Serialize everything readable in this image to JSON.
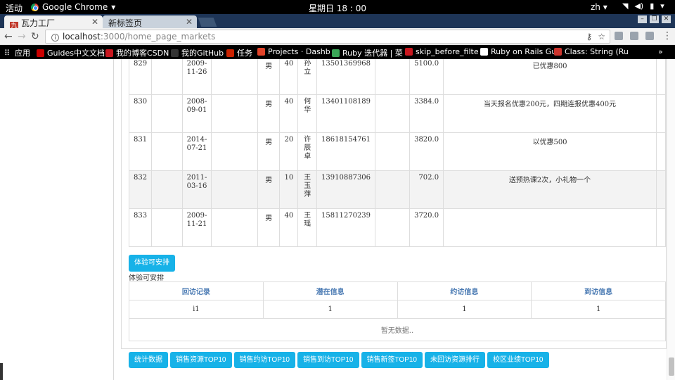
{
  "system": {
    "activities": "活动",
    "app_name": "Google Chrome",
    "clock": "星期日 18 : 00",
    "lang": "zh"
  },
  "tabs": [
    {
      "title": "瓦力工厂",
      "favicon": "九",
      "active": true
    },
    {
      "title": "新标签页",
      "active": false
    }
  ],
  "address": {
    "host": "localhost",
    "path": ":3000/home_page_markets"
  },
  "bookmarks": [
    {
      "label": "应用",
      "icon": "apps-icon"
    },
    {
      "label": "Guides中文文档",
      "icon": "rails-icon",
      "color": "#cc0000"
    },
    {
      "label": "我的博客CSDN",
      "icon": "csdn-icon",
      "color": "#c9171f"
    },
    {
      "label": "我的GitHub",
      "icon": "github-icon",
      "color": "#333333"
    },
    {
      "label": "任务",
      "icon": "task-icon",
      "color": "#cc2200"
    },
    {
      "label": "Projects · Dashb",
      "icon": "gitlab-icon",
      "color": "#e24329"
    },
    {
      "label": "Ruby 迭代器 | 菜",
      "icon": "ruby-icon",
      "color": "#3aa757"
    },
    {
      "label": "skip_before_filte",
      "icon": "csdn-icon",
      "color": "#c9171f"
    },
    {
      "label": "Ruby on Rails Gu",
      "icon": "page-icon",
      "color": "#ffffff"
    },
    {
      "label": "Class: String (Ru",
      "icon": "ruby-icon",
      "color": "#cc342d"
    }
  ],
  "records": [
    {
      "id": "829",
      "date": [
        "2009-",
        "11-26"
      ],
      "gender": "男",
      "age": "40",
      "name": [
        "孙",
        "立"
      ],
      "phone": "13501369968",
      "price": "5100.0",
      "note": "已优惠800",
      "striped": false
    },
    {
      "id": "830",
      "date": [
        "2008-",
        "09-01"
      ],
      "gender": "男",
      "age": "40",
      "name": [
        "何",
        "华"
      ],
      "phone": "13401108189",
      "price": "3384.0",
      "note": "当天报名优惠200元，四期连报优惠400元",
      "striped": false
    },
    {
      "id": "831",
      "date": [
        "2014-",
        "07-21"
      ],
      "gender": "男",
      "age": "20",
      "name": [
        "许",
        "辰",
        "卓"
      ],
      "phone": "18618154761",
      "price": "3820.0",
      "note": "以优惠500",
      "striped": false
    },
    {
      "id": "832",
      "date": [
        "2011-",
        "03-16"
      ],
      "gender": "男",
      "age": "10",
      "name": [
        "王",
        "玉",
        "萍"
      ],
      "phone": "13910887306",
      "price": "702.0",
      "note": "送预热课2次，小礼物一个",
      "striped": true
    },
    {
      "id": "833",
      "date": [
        "2009-",
        "11-21"
      ],
      "gender": "男",
      "age": "40",
      "name": [
        "王",
        "瑶"
      ],
      "phone": "15811270239",
      "price": "3720.0",
      "note": "",
      "striped": false
    }
  ],
  "trial": {
    "button": "体验可安排",
    "label": "体验可安排",
    "headers": [
      "回访记录",
      "潜在信息",
      "约访信息",
      "到访信息"
    ],
    "row": [
      "i1",
      "1",
      "1",
      "1"
    ],
    "empty": "暂无数据.."
  },
  "bottom_buttons": [
    "统计数据",
    "销售资源TOP10",
    "销售约访TOP10",
    "销售到访TOP10",
    "销售新签TOP10",
    "未回访资源排行",
    "校区业绩TOP10"
  ],
  "colors": {
    "button": "#17b2e8",
    "header_text": "#4a7ab3",
    "tabstrip": "#1e3557"
  }
}
